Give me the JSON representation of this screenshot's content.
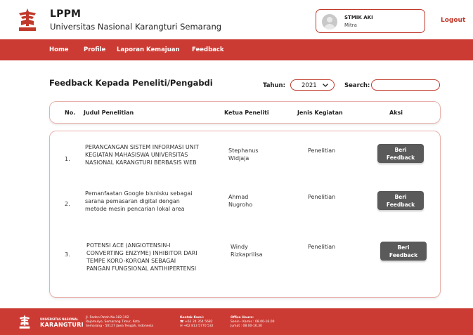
{
  "header": {
    "brand_title": "LPPM",
    "brand_subtitle": "Universitas Nasional Karangturi Semarang",
    "user_name": "STMIK AKI",
    "user_role": "Mitra",
    "logout_label": "Logout"
  },
  "navbar": {
    "items": [
      "Home",
      "Profile",
      "Laporan Kemajuan",
      "Feedback"
    ]
  },
  "page": {
    "title": "Feedback Kepada Peneliti/Pengabdi",
    "tahun_label": "Tahun:",
    "tahun_value": "2021",
    "search_label": "Search:",
    "search_value": ""
  },
  "table": {
    "headers": [
      "No.",
      "Judul Penelitian",
      "Ketua Peneliti",
      "Jenis Kegiatan",
      "Aksi"
    ],
    "rows": [
      {
        "no": "1.",
        "title_lines": [
          "PERANCANGAN SISTEM INFORMASI UNIT",
          "KEGIATAN MAHASISWA UNIVERSITAS",
          "NASIONAL KARANGTURI BERBASIS WEB"
        ],
        "ketua_lines": [
          "Stephanus",
          "Widjaja"
        ],
        "jenis": "Penelitian",
        "action_lines": [
          "Beri",
          "Feedback"
        ]
      },
      {
        "no": "2.",
        "title_lines": [
          "Pemanfaatan Google bisnisku sebagai",
          "sarana pemasaran digital dengan",
          "metode mesin pencarian lokal area"
        ],
        "ketua_lines": [
          "Ahmad",
          "Nugroho"
        ],
        "jenis": "Penelitian",
        "action_lines": [
          "Beri",
          "Feedback"
        ]
      },
      {
        "no": "3.",
        "title_lines": [
          "POTENSI ACE (ANGIOTENSIN-I",
          "CONVERTING ENZYME) INHIBITOR DARI",
          "TEMPE KORO-KOROAN SEBAGAI",
          "PANGAN FUNGSIONAL ANTIHIPERTENSI"
        ],
        "ketua_lines": [
          "Windy",
          "Rizkaprilisa"
        ],
        "jenis": "Penelitian",
        "action_lines": [
          "Beri",
          "Feedback"
        ]
      }
    ]
  },
  "footer": {
    "brand_small": "UNIVERSITAS NASIONAL",
    "brand_big": "KARANGTURI",
    "address_lines": [
      "Jl. Raden Patah No.182-192",
      "Rejomulyo, Semarang Timur, Kota",
      "Semarang - 50127 Jawa Tengah, Indonesia"
    ],
    "contact_title": "Kontak Kami:",
    "contact_lines": [
      "☎ +62 24 354 5682",
      "✉ +62 813 5770 532"
    ],
    "hours_title": "Office Hours:",
    "hours_lines": [
      "Senin - Kamis : 08.00-16.00",
      "Jumat : 08.00-16.30"
    ]
  },
  "colors": {
    "brand_red": "#cc3b33",
    "button_gray": "#5a5a5a"
  }
}
